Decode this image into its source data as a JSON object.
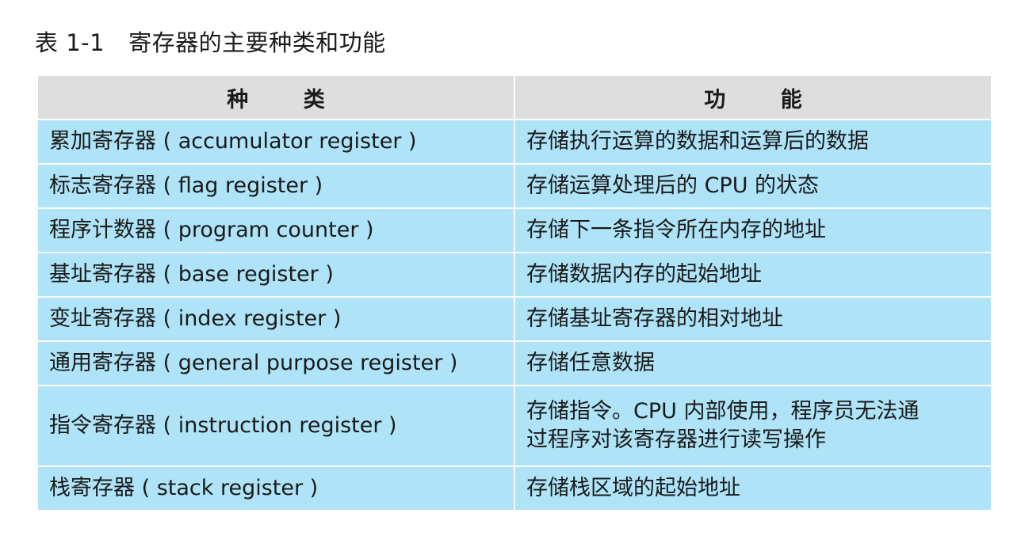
{
  "caption": {
    "number": "表 1-1",
    "title": "寄存器的主要种类和功能"
  },
  "table": {
    "headers": [
      "种 类",
      "功 能"
    ],
    "rows": [
      {
        "kind": "累加寄存器 ( accumulator register )",
        "func": "存储执行运算的数据和运算后的数据"
      },
      {
        "kind": "标志寄存器 ( flag register )",
        "func": "存储运算处理后的 CPU 的状态"
      },
      {
        "kind": "程序计数器 ( program counter )",
        "func": "存储下一条指令所在内存的地址"
      },
      {
        "kind": "基址寄存器 ( base register )",
        "func": "存储数据内存的起始地址"
      },
      {
        "kind": "变址寄存器 ( index register )",
        "func": "存储基址寄存器的相对地址"
      },
      {
        "kind": "通用寄存器 ( general purpose register )",
        "func": "存储任意数据"
      },
      {
        "kind": "指令寄存器 ( instruction register )",
        "func": "存储指令。CPU 内部使用，程序员无法通\n过程序对该寄存器进行读写操作"
      },
      {
        "kind": "栈寄存器 ( stack register )",
        "func": "存储栈区域的起始地址"
      }
    ]
  }
}
